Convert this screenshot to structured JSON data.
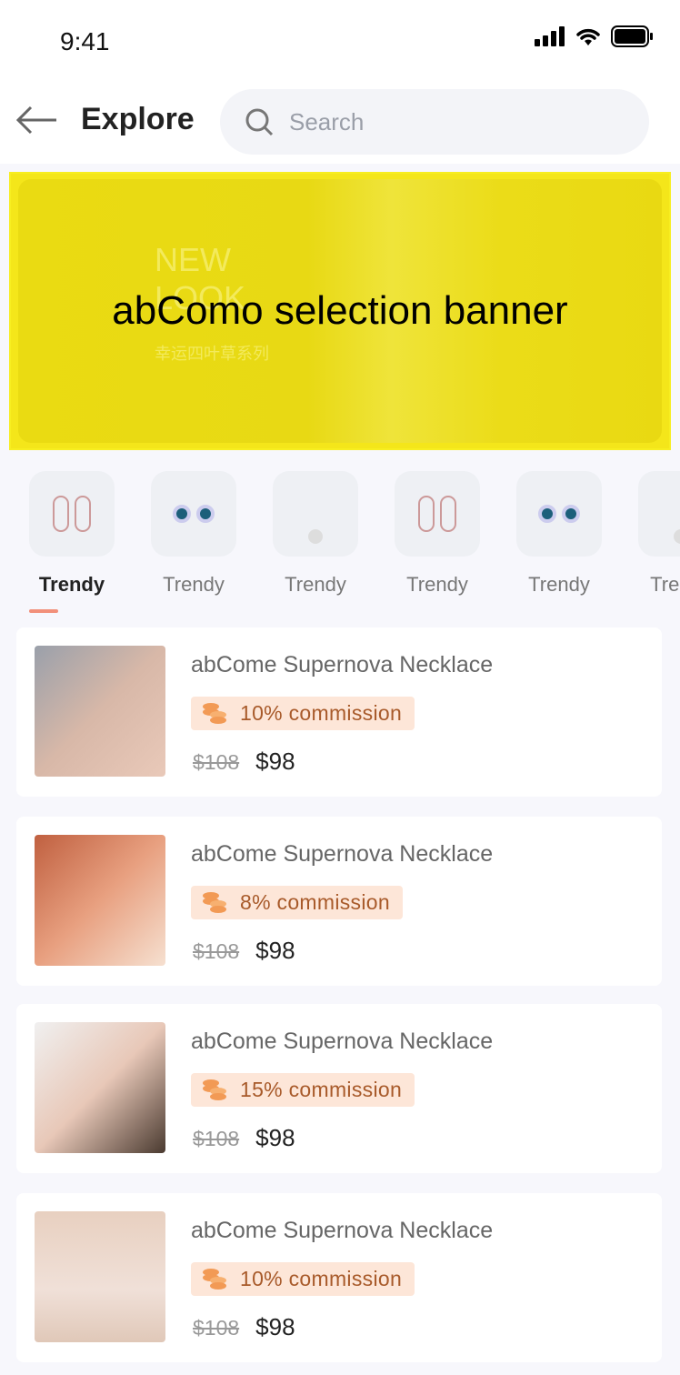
{
  "status": {
    "time": "9:41"
  },
  "header": {
    "title": "Explore",
    "search_placeholder": "Search"
  },
  "banner": {
    "label": "abComo selection banner",
    "line1": "NEW",
    "line2": "LOOK",
    "subtitle": "幸运四叶草系列"
  },
  "categories": [
    {
      "label": "Trendy",
      "active": true
    },
    {
      "label": "Trendy"
    },
    {
      "label": "Trendy"
    },
    {
      "label": "Trendy"
    },
    {
      "label": "Trendy"
    },
    {
      "label": "Trendy"
    }
  ],
  "products": [
    {
      "title": "abCome Supernova Necklace",
      "commission": "10% commission",
      "old_price": "$108",
      "price": "$98"
    },
    {
      "title": "abCome Supernova Necklace",
      "commission": "8% commission",
      "old_price": "$108",
      "price": "$98"
    },
    {
      "title": "abCome Supernova Necklace",
      "commission": "15% commission",
      "old_price": "$108",
      "price": "$98"
    },
    {
      "title": "abCome Supernova Necklace",
      "commission": "10% commission",
      "old_price": "$108",
      "price": "$98"
    }
  ],
  "colors": {
    "accent": "#f2907a",
    "badge_bg": "#fde6d8",
    "badge_text": "#a85a2a",
    "banner": "#f4e61a"
  }
}
